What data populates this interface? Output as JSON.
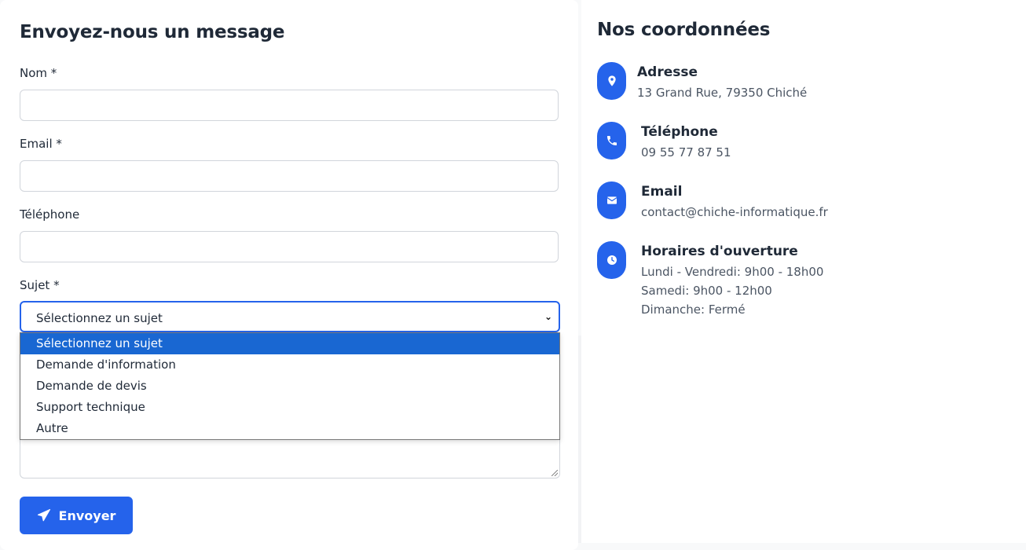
{
  "form": {
    "title": "Envoyez-nous un message",
    "name_label": "Nom *",
    "email_label": "Email *",
    "phone_label": "Téléphone",
    "subject_label": "Sujet *",
    "subject_selected": "Sélectionnez un sujet",
    "subject_options": [
      "Sélectionnez un sujet",
      "Demande d'information",
      "Demande de devis",
      "Support technique",
      "Autre"
    ],
    "submit_label": "Envoyer"
  },
  "contact": {
    "title": "Nos coordonnées",
    "address": {
      "icon": "map-pin-icon",
      "heading": "Adresse",
      "text": "13 Grand Rue, 79350 Chiché"
    },
    "phone": {
      "icon": "phone-icon",
      "heading": "Téléphone",
      "text": "09 55 77 87 51"
    },
    "email": {
      "icon": "envelope-icon",
      "heading": "Email",
      "text": "contact@chiche-informatique.fr"
    },
    "hours": {
      "icon": "clock-icon",
      "heading": "Horaires d'ouverture",
      "lines": [
        "Lundi - Vendredi: 9h00 - 18h00",
        "Samedi: 9h00 - 12h00",
        "Dimanche: Fermé"
      ]
    }
  },
  "colors": {
    "accent": "#2563eb",
    "selected_option": "#1967d2"
  }
}
